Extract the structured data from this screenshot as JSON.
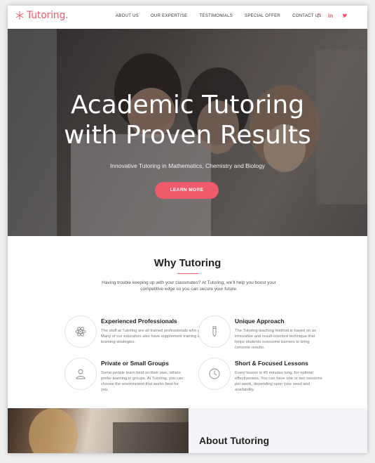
{
  "brand": {
    "name": "Tutoring.",
    "accent": "#ef5b6b"
  },
  "nav": {
    "items": [
      {
        "label": "ABOUT US"
      },
      {
        "label": "OUR EXPERTISE"
      },
      {
        "label": "TESTIMONIALS"
      },
      {
        "label": "SPECIAL OFFER"
      },
      {
        "label": "CONTACT US"
      }
    ]
  },
  "social": [
    {
      "icon": "facebook-icon",
      "glyph": "f"
    },
    {
      "icon": "linkedin-icon",
      "glyph": "in"
    },
    {
      "icon": "twitter-icon",
      "glyph": "t"
    }
  ],
  "hero": {
    "title_line1": "Academic Tutoring",
    "title_line2": "with Proven Results",
    "subtitle": "Innovative Tutoring in Mathematics, Chemistry and Biology",
    "cta": "LEARN MORE"
  },
  "why": {
    "title": "Why Tutoring",
    "intro": "Having trouble keeping up with your classmates? At Tutoring, we'll help you boost your competitive edge so you can secure your future.",
    "features": [
      {
        "icon": "atom-icon",
        "title": "Experienced Professionals",
        "text": "The staff at Tutoring are all trained professionals who excel in their field. Many of our educators also have supplement training in alternative learning strategies."
      },
      {
        "icon": "pencil-icon",
        "title": "Unique Approach",
        "text": "The Tutoring teaching method is based on an innovative and result-oriented technique that helps students overcome barriers to bring concrete results."
      },
      {
        "icon": "user-icon",
        "title": "Private or Small Groups",
        "text": "Some people learn best on their own, others prefer learning in groups. At Tutoring, you can choose the environment that works best for you."
      },
      {
        "icon": "clock-icon",
        "title": "Short & Focused Lessons",
        "text": "Every lesson is 45 minutes long, for optimal effectiveness. You can have one or two sessions per week, depending upon your need and availability."
      }
    ]
  },
  "about": {
    "title": "About Tutoring"
  }
}
